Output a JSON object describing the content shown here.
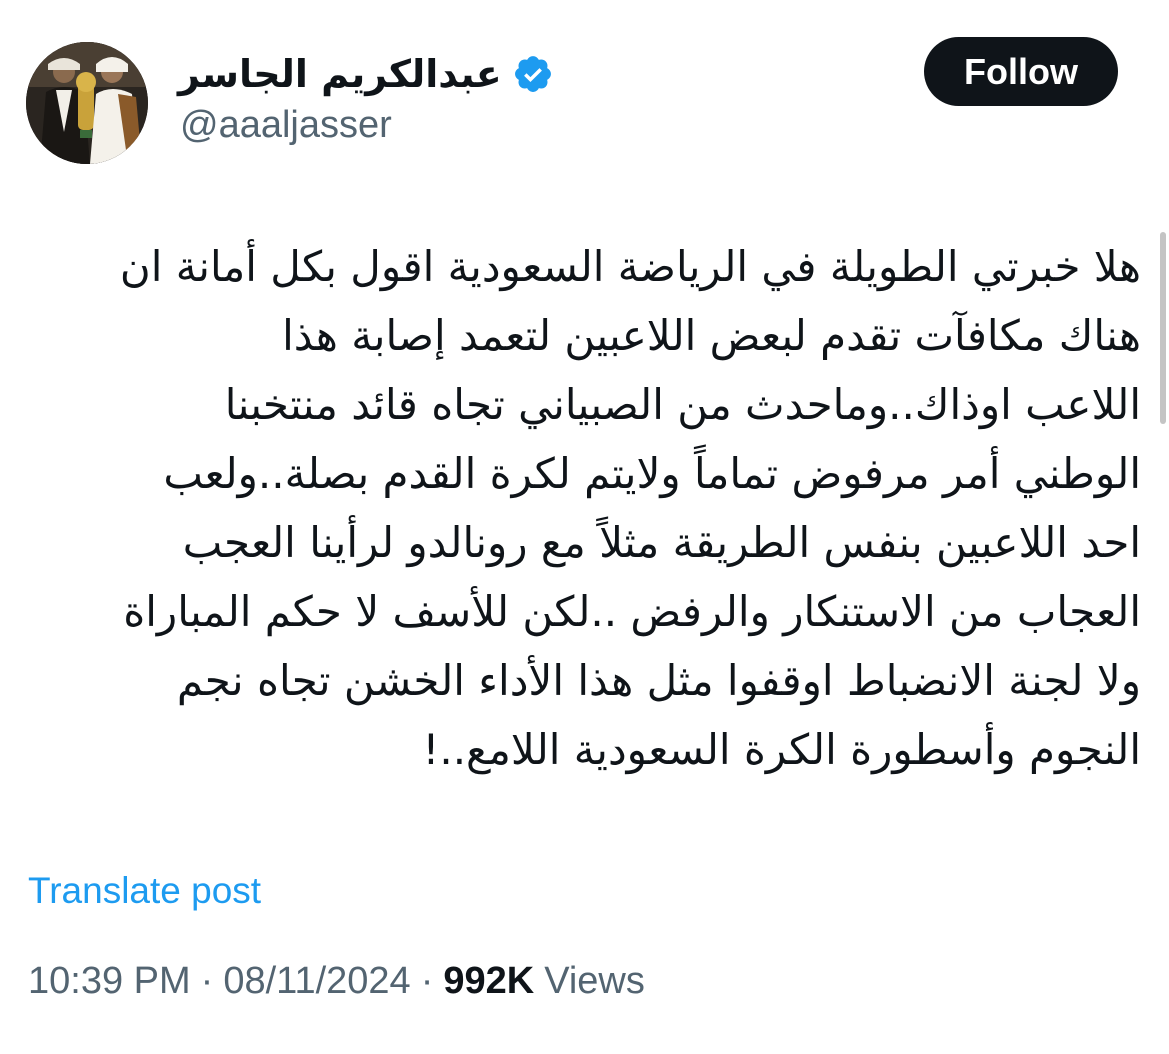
{
  "author": {
    "display_name": "عبدالكريم الجاسر",
    "handle": "@aaaljasser",
    "verified": true,
    "verified_color": "#1d9bf0"
  },
  "follow_button": {
    "label": "Follow"
  },
  "tweet": {
    "lines": [
      "هلا خبرتي الطويلة في الرياضة السعودية اقول بكل أمانة ان",
      "هناك مكافآت تقدم لبعض اللاعبين لتعمد إصابة هذا",
      "اللاعب اوذاك..وماحدث من الصبياني تجاه قائد منتخبنا",
      "الوطني أمر مرفوض تماماً ولايتم لكرة القدم بصلة..ولعب",
      "احد اللاعبين بنفس الطريقة مثلاً مع رونالدو لرأينا العجب",
      "العجاب من الاستنكار والرفض ..لكن للأسف لا حكم المباراة",
      "ولا لجنة الانضباط  اوقفوا مثل هذا الأداء الخشن تجاه نجم",
      "النجوم وأسطورة الكرة السعودية اللامع..!"
    ]
  },
  "translate_link": "Translate post",
  "meta": {
    "time": "10:39 PM",
    "date": "08/11/2024",
    "separator": "·",
    "views_count": "992K",
    "views_label": "Views"
  },
  "colors": {
    "text_primary": "#0f1419",
    "text_secondary": "#536471",
    "link": "#1d9bf0",
    "follow_bg": "#0f1419"
  }
}
